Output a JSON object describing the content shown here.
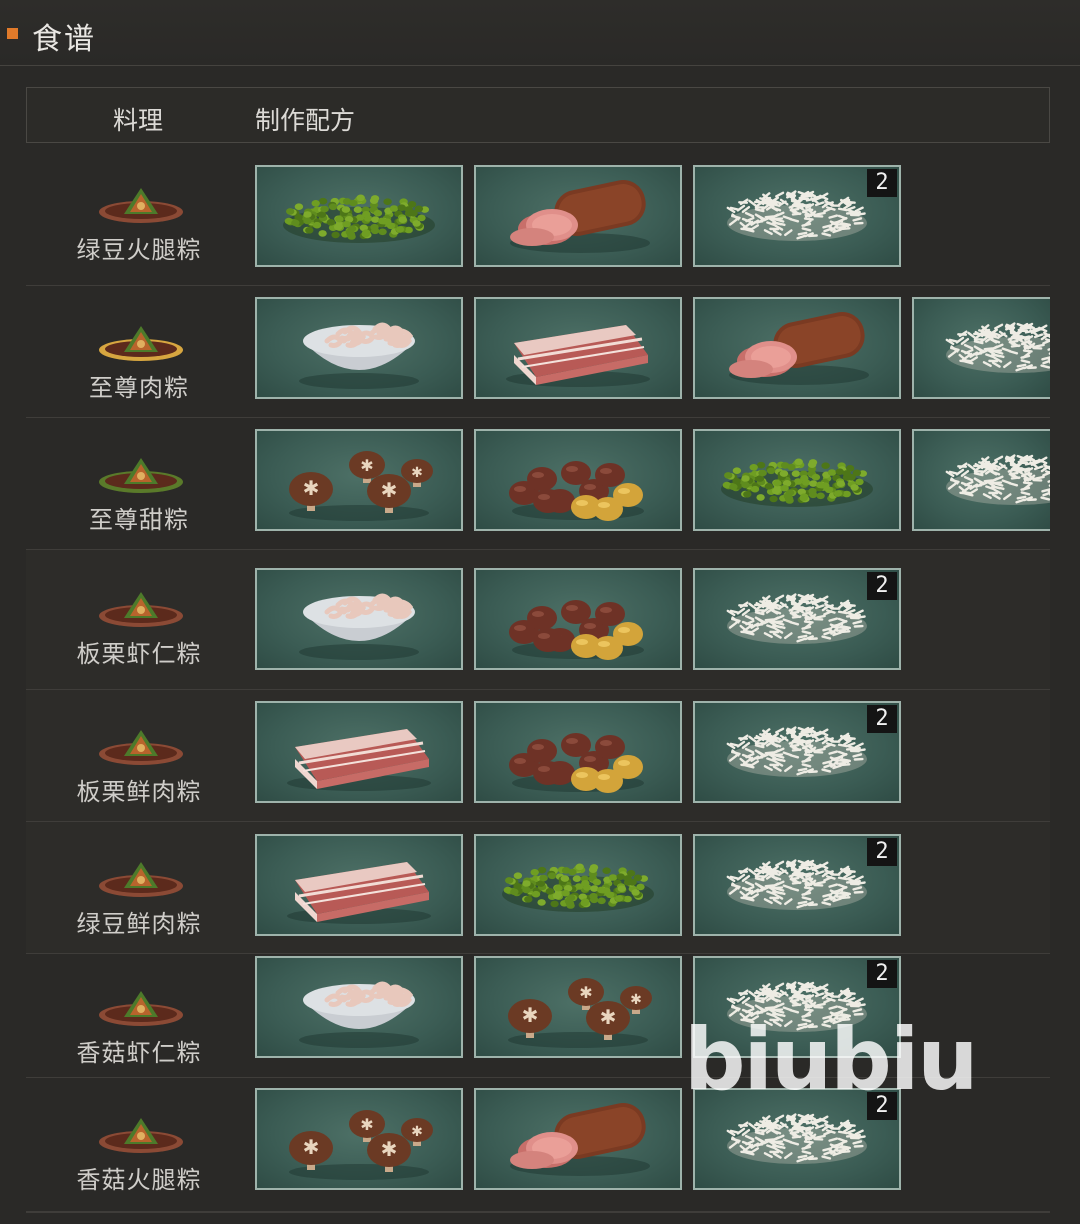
{
  "header": {
    "title": "食谱"
  },
  "table": {
    "col_dish": "料理",
    "col_recipe": "制作配方"
  },
  "rows": [
    {
      "name": "绿豆火腿粽",
      "ingredients": [
        {
          "icon": "mung-bean-icon",
          "qty": ""
        },
        {
          "icon": "ham-icon",
          "qty": ""
        },
        {
          "icon": "rice-icon",
          "qty": "2"
        }
      ]
    },
    {
      "name": "至尊肉粽",
      "ingredients": [
        {
          "icon": "shrimp-bowl-icon",
          "qty": ""
        },
        {
          "icon": "pork-belly-icon",
          "qty": ""
        },
        {
          "icon": "ham-icon",
          "qty": ""
        },
        {
          "icon": "rice-icon",
          "qty": ""
        }
      ]
    },
    {
      "name": "至尊甜粽",
      "ingredients": [
        {
          "icon": "shiitake-icon",
          "qty": ""
        },
        {
          "icon": "chestnut-icon",
          "qty": ""
        },
        {
          "icon": "mung-bean-icon",
          "qty": ""
        },
        {
          "icon": "rice-icon",
          "qty": ""
        }
      ]
    },
    {
      "name": "板栗虾仁粽",
      "ingredients": [
        {
          "icon": "shrimp-bowl-icon",
          "qty": ""
        },
        {
          "icon": "chestnut-icon",
          "qty": ""
        },
        {
          "icon": "rice-icon",
          "qty": "2"
        }
      ]
    },
    {
      "name": "板栗鲜肉粽",
      "ingredients": [
        {
          "icon": "pork-belly-icon",
          "qty": ""
        },
        {
          "icon": "chestnut-icon",
          "qty": ""
        },
        {
          "icon": "rice-icon",
          "qty": "2"
        }
      ]
    },
    {
      "name": "绿豆鲜肉粽",
      "ingredients": [
        {
          "icon": "pork-belly-icon",
          "qty": ""
        },
        {
          "icon": "mung-bean-icon",
          "qty": ""
        },
        {
          "icon": "rice-icon",
          "qty": "2"
        }
      ]
    },
    {
      "name": "香菇虾仁粽",
      "ingredients": [
        {
          "icon": "shrimp-bowl-icon",
          "qty": ""
        },
        {
          "icon": "shiitake-icon",
          "qty": ""
        },
        {
          "icon": "rice-icon",
          "qty": "2"
        }
      ]
    },
    {
      "name": "香菇火腿粽",
      "ingredients": [
        {
          "icon": "shiitake-icon",
          "qty": ""
        },
        {
          "icon": "ham-icon",
          "qty": ""
        },
        {
          "icon": "rice-icon",
          "qty": "2"
        }
      ]
    }
  ],
  "watermark": "biubiu"
}
